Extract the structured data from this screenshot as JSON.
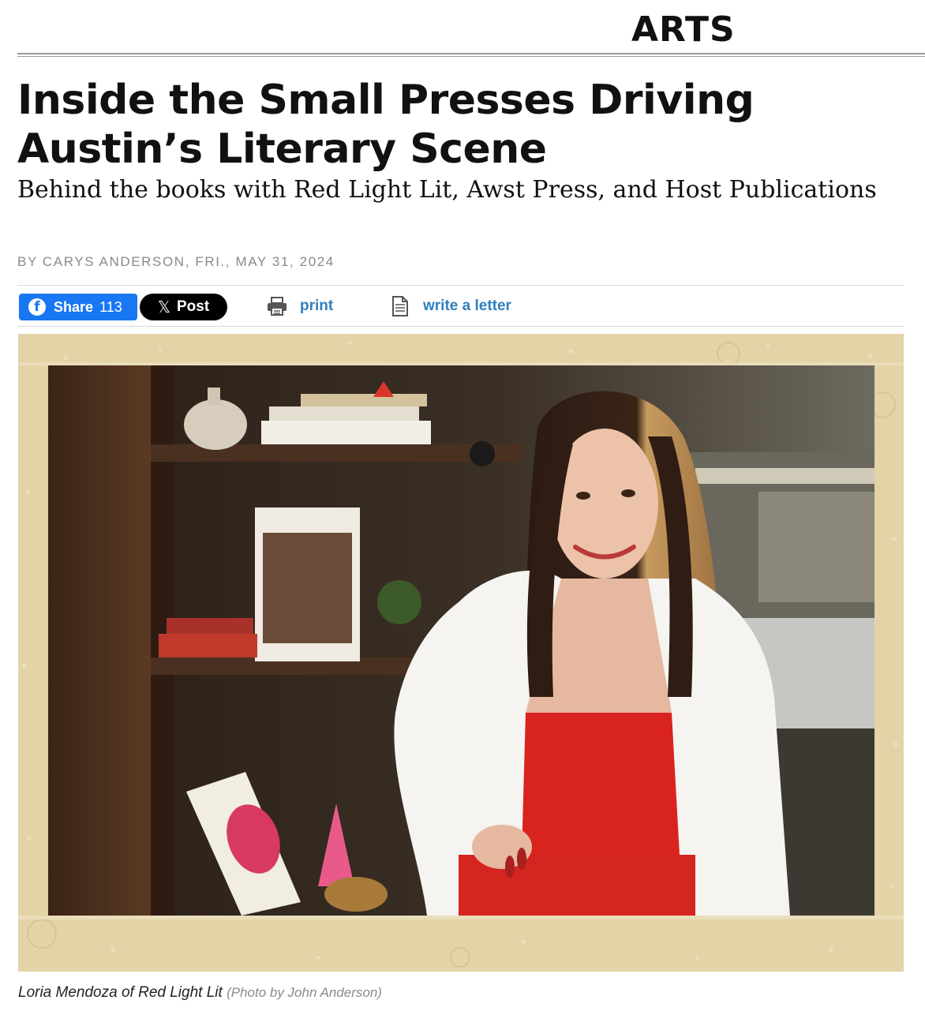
{
  "section": {
    "label": "ARTS"
  },
  "article": {
    "headline": "Inside the Small Presses Driving Austin’s Literary Scene",
    "deck": "Behind the books with Red Light Lit, Awst Press, and Host Publications",
    "byline": "BY CARYS ANDERSON, FRI., MAY 31, 2024"
  },
  "share": {
    "facebook": {
      "label": "Share",
      "count": "113",
      "icon": "facebook-icon"
    },
    "x": {
      "label": "Post",
      "icon": "x-logo-icon"
    },
    "print": {
      "label": "print",
      "icon": "printer-icon"
    },
    "letter": {
      "label": "write a letter",
      "icon": "document-icon"
    }
  },
  "photo": {
    "caption": "Loria Mendoza of Red Light Lit",
    "credit": "(Photo by John Anderson)"
  },
  "colors": {
    "facebook_blue": "#1877f2",
    "link_blue": "#2f7fbf",
    "frame_tan": "#e3d3a6"
  }
}
